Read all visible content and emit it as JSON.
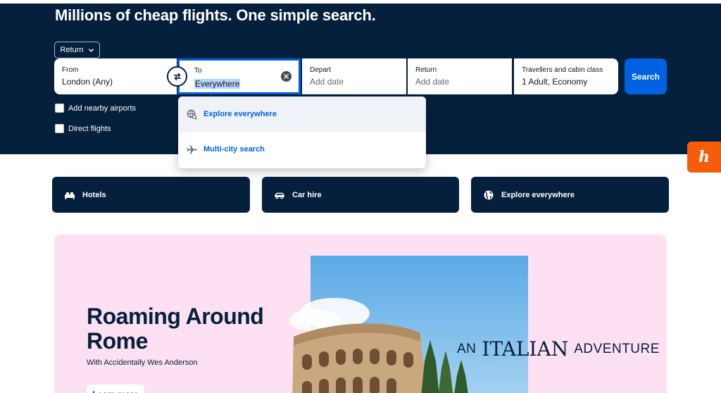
{
  "hero": {
    "title": "Millions of cheap flights. One simple search.",
    "trip_type": "Return"
  },
  "search_form": {
    "from": {
      "label": "From",
      "value": "London (Any)"
    },
    "to": {
      "label": "To",
      "value": "Everywhere"
    },
    "depart": {
      "label": "Depart",
      "placeholder": "Add date"
    },
    "return": {
      "label": "Return",
      "placeholder": "Add date"
    },
    "travellers": {
      "label": "Travellers and cabin class",
      "value": "1 Adult, Economy"
    },
    "search_label": "Search",
    "options": {
      "nearby_airports": "Add nearby airports",
      "direct_flights": "Direct flights"
    }
  },
  "destination_dropdown": {
    "items": [
      {
        "label": "Explore everywhere",
        "icon": "globe-search-icon"
      },
      {
        "label": "Multi-city search",
        "icon": "plane-icon"
      }
    ]
  },
  "side_badge": {
    "letter": "h"
  },
  "quick_links": [
    {
      "label": "Hotels",
      "icon": "bed-icon"
    },
    {
      "label": "Car hire",
      "icon": "car-icon"
    },
    {
      "label": "Explore everywhere",
      "icon": "globe-icon"
    }
  ],
  "promo": {
    "title": "Roaming Around Rome",
    "subtitle": "With Accidentally Wes Anderson",
    "button_label": "Learn more",
    "tagline": {
      "part1": "AN",
      "part2": "ITALIAN",
      "part3": "ADVENTURE"
    }
  },
  "colors": {
    "navy": "#05203c",
    "primary_blue": "#0062e3",
    "promo_pink": "#fde0f2",
    "badge_orange": "#f55d0b"
  }
}
